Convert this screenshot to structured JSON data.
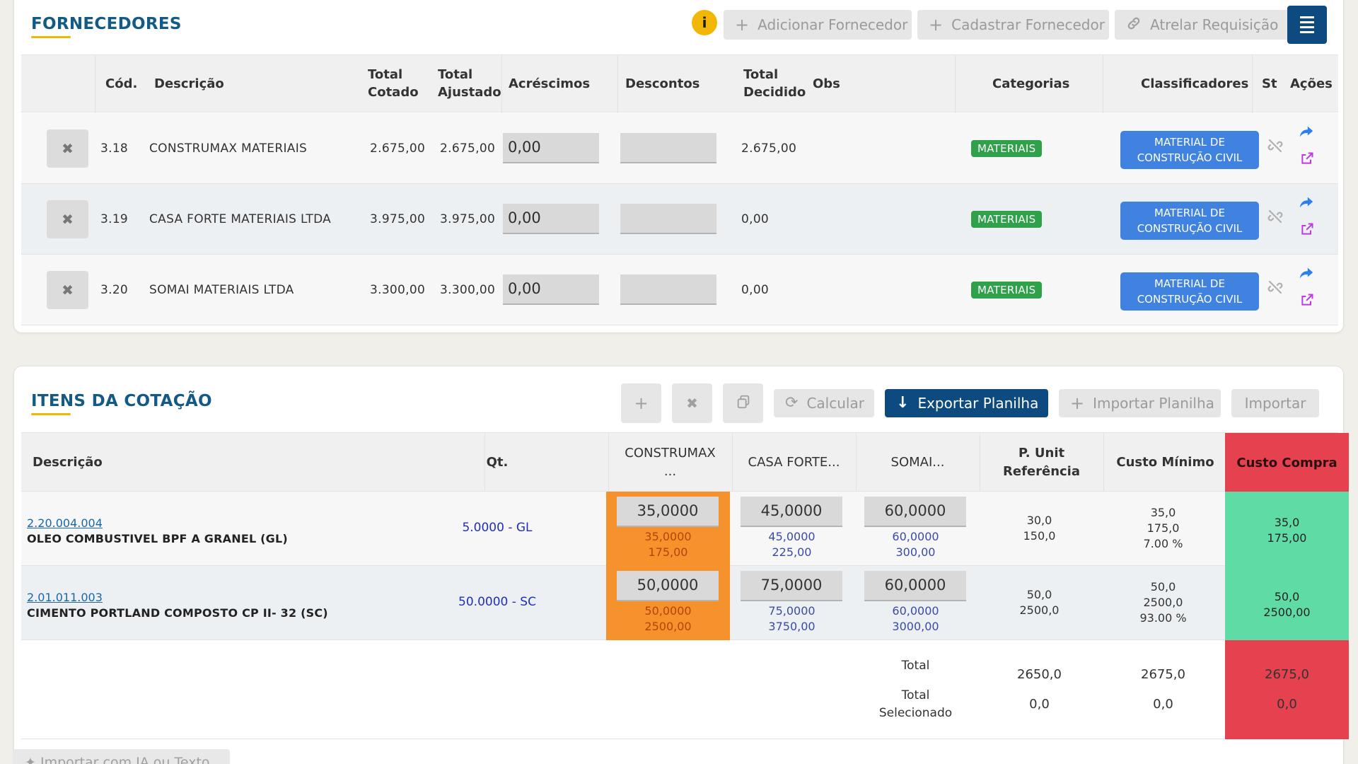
{
  "fornecedores": {
    "title": "FORNECEDORES",
    "buttons": {
      "info": "i",
      "adicionar": "Adicionar Fornecedor",
      "cadastrar": "Cadastrar Fornecedor",
      "atrelar": "Atrelar Requisição"
    },
    "headers": {
      "cod": "Cód.",
      "descricao": "Descrição",
      "total_cotado_1": "Total",
      "total_cotado_2": "Cotado",
      "total_ajustado_1": "Total",
      "total_ajustado_2": "Ajustado",
      "acrescimos": "Acréscimos",
      "descontos": "Descontos",
      "total_decidido_1": "Total",
      "total_decidido_2": "Decidido",
      "obs": "Obs",
      "categorias": "Categorias",
      "classificadores": "Classificadores",
      "st": "St",
      "acoes": "Ações"
    },
    "rows": [
      {
        "cod": "3.18",
        "descricao": "CONSTRUMAX MATERIAIS",
        "total_cotado": "2.675,00",
        "total_ajustado": "2.675,00",
        "acrescimos": "0,00",
        "descontos": "",
        "total_decidido": "2.675,00",
        "categoria": "MATERIAIS",
        "classificador_1": "MATERIAL DE",
        "classificador_2": "CONSTRUÇÃO CIVIL"
      },
      {
        "cod": "3.19",
        "descricao": "CASA FORTE MATERIAIS LTDA",
        "total_cotado": "3.975,00",
        "total_ajustado": "3.975,00",
        "acrescimos": "0,00",
        "descontos": "",
        "total_decidido": "0,00",
        "categoria": "MATERIAIS",
        "classificador_1": "MATERIAL DE",
        "classificador_2": "CONSTRUÇÃO CIVIL"
      },
      {
        "cod": "3.20",
        "descricao": "SOMAI MATERIAIS LTDA",
        "total_cotado": "3.300,00",
        "total_ajustado": "3.300,00",
        "acrescimos": "0,00",
        "descontos": "",
        "total_decidido": "0,00",
        "categoria": "MATERIAIS",
        "classificador_1": "MATERIAL DE",
        "classificador_2": "CONSTRUÇÃO CIVIL"
      }
    ]
  },
  "itens": {
    "title": "ITENS DA COTAÇÃO",
    "buttons": {
      "calcular": "Calcular",
      "exportar": "Exportar Planilha",
      "importar_planilha": "Importar Planilha",
      "importar": "Importar",
      "importar_ia": "Importar com IA ou Texto"
    },
    "headers": {
      "descricao": "Descrição",
      "qt": "Qt.",
      "sup1_1": "CONSTRUMAX",
      "sup1_2": "...",
      "sup2": "CASA FORTE...",
      "sup3": "SOMAI...",
      "punit_1": "P. Unit",
      "punit_2": "Referência",
      "custo_minimo": "Custo Mínimo",
      "custo_compra": "Custo Compra"
    },
    "rows": [
      {
        "code": "2.20.004.004",
        "descricao": "OLEO COMBUSTIVEL BPF A GRANEL (GL)",
        "qt": "5.0000 - GL",
        "sup1": {
          "input": "35,0000",
          "unit": "35,0000",
          "total": "175,00"
        },
        "sup2": {
          "input": "45,0000",
          "unit": "45,0000",
          "total": "225,00"
        },
        "sup3": {
          "input": "60,0000",
          "unit": "60,0000",
          "total": "300,00"
        },
        "punit": [
          "30,0",
          "150,0"
        ],
        "custo_minimo": [
          "35,0",
          "175,0",
          "7.00 %"
        ],
        "custo_compra": [
          "35,0",
          "175,00"
        ]
      },
      {
        "code": "2.01.011.003",
        "descricao": "CIMENTO PORTLAND COMPOSTO CP II- 32 (SC)",
        "qt": "50.0000 - SC",
        "sup1": {
          "input": "50,0000",
          "unit": "50,0000",
          "total": "2500,00"
        },
        "sup2": {
          "input": "75,0000",
          "unit": "75,0000",
          "total": "3750,00"
        },
        "sup3": {
          "input": "60,0000",
          "unit": "60,0000",
          "total": "3000,00"
        },
        "punit": [
          "50,0",
          "2500,0"
        ],
        "custo_minimo": [
          "50,0",
          "2500,0",
          "93.00 %"
        ],
        "custo_compra": [
          "50,0",
          "2500,00"
        ]
      }
    ],
    "totals": {
      "total_label": "Total",
      "sel_label_1": "Total",
      "sel_label_2": "Selecionado",
      "punit_total": "2650,0",
      "minimo_total": "2675,0",
      "compra_total": "2675,0",
      "punit_sel": "0,0",
      "minimo_sel": "0,0",
      "compra_sel": "0,0"
    }
  },
  "colors": {
    "brand_blue": "#0c4a80",
    "accent_yellow": "#f2b705",
    "best_orange": "#f5922c",
    "compra_green": "#5fdca5",
    "compra_red": "#e5414e",
    "badge_green": "#2fa14b",
    "badge_blue": "#3f82e0"
  }
}
